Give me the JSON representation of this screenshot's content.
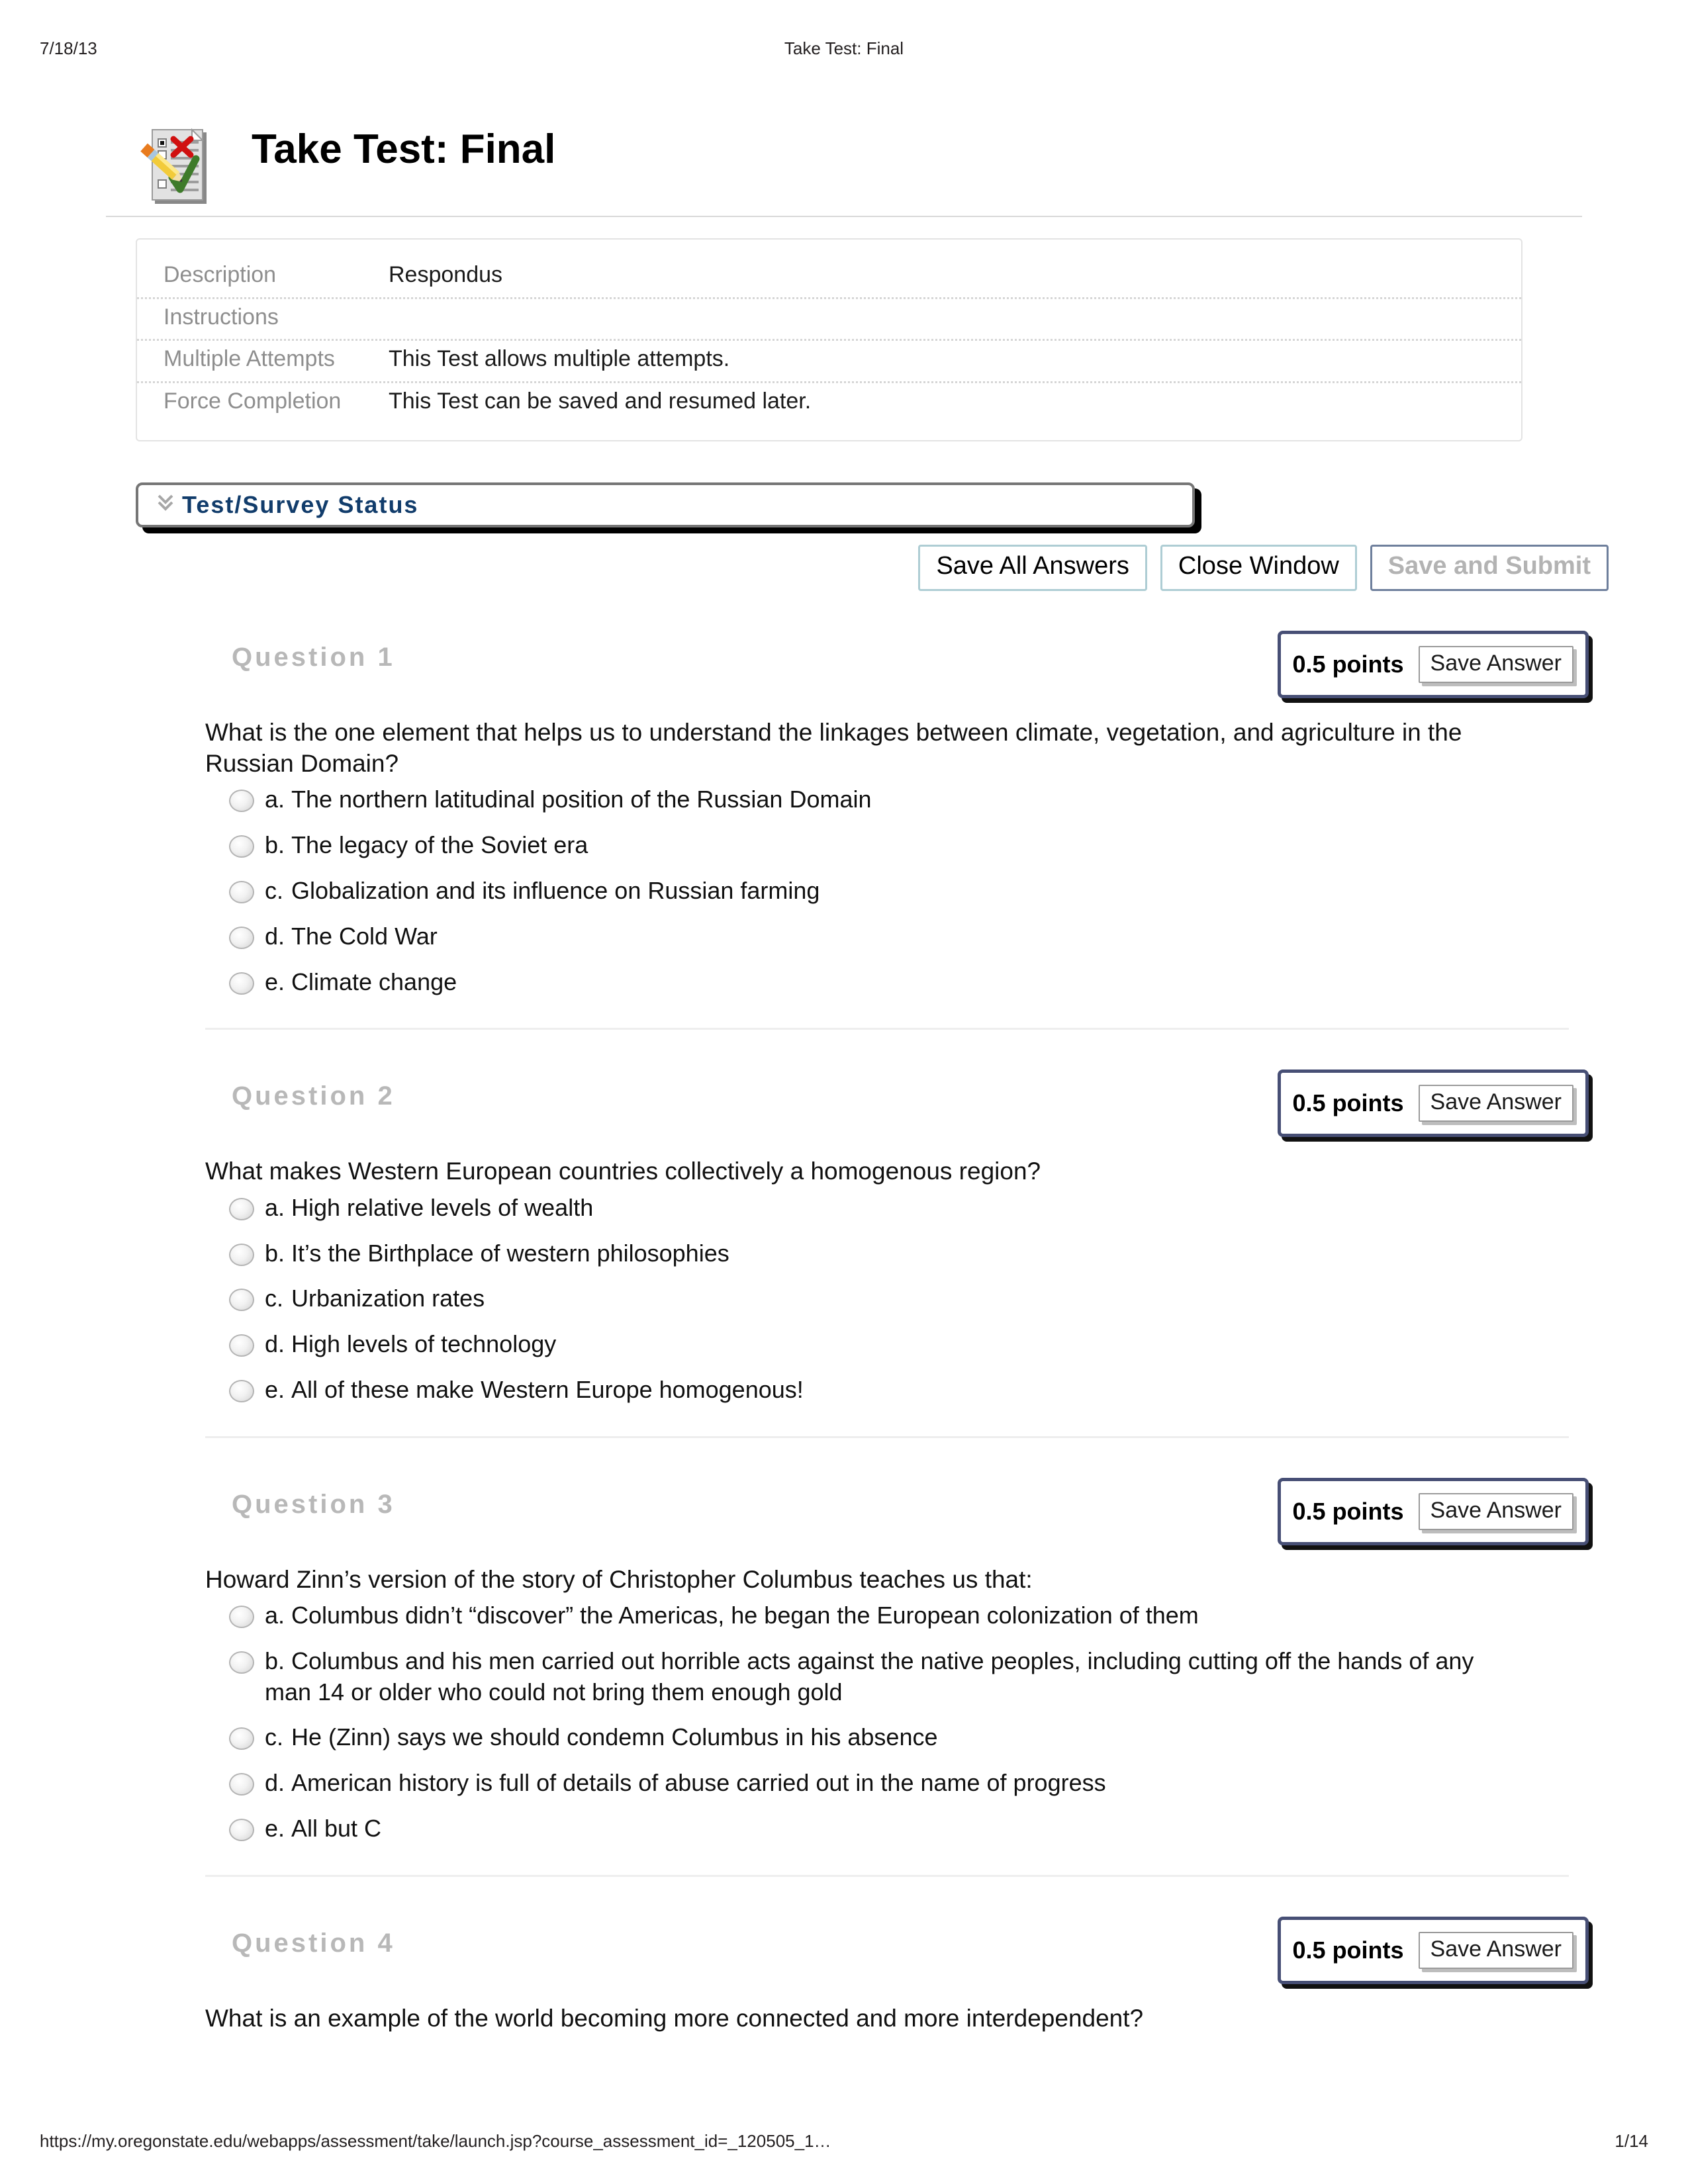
{
  "print_header": {
    "date": "7/18/13",
    "title": "Take Test: Final"
  },
  "print_footer": {
    "url": "https://my.oregonstate.edu/webapps/assessment/take/launch.jsp?course_assessment_id=_120505_1…",
    "page": "1/14"
  },
  "page_title": "Take Test: Final",
  "icon": "test-checklist-icon",
  "details": {
    "rows": [
      {
        "label": "Description",
        "value": "Respondus"
      },
      {
        "label": "Instructions",
        "value": ""
      },
      {
        "label": "Multiple Attempts",
        "value": "This Test allows multiple attempts."
      },
      {
        "label": "Force Completion",
        "value": "This Test can be saved and resumed later."
      }
    ]
  },
  "status": {
    "chevron": "»",
    "label": "Test/Survey Status"
  },
  "toolbar": {
    "save_all_label": "Save All Answers",
    "close_window_label": "Close Window",
    "save_submit_label": "Save and Submit"
  },
  "colors": {
    "accent_blue": "#113c6b",
    "points_border": "#474f75",
    "button_border": "#aecdd4",
    "disabled_text": "#b3b3b3",
    "question_number": "#b8b8b8"
  },
  "save_answer_label": "Save Answer",
  "questions": [
    {
      "number": "Question 1",
      "points": "0.5 points",
      "text": "What is the one element that helps us to understand the linkages between climate, vegetation, and agriculture in the Russian Domain?",
      "options": [
        {
          "letter": "a.",
          "text": "The northern latitudinal position of the Russian Domain"
        },
        {
          "letter": "b.",
          "text": "The legacy of the Soviet era"
        },
        {
          "letter": "c.",
          "text": "Globalization and its influence on Russian farming"
        },
        {
          "letter": "d.",
          "text": "The Cold War"
        },
        {
          "letter": "e.",
          "text": "Climate change"
        }
      ]
    },
    {
      "number": "Question 2",
      "points": "0.5 points",
      "text": "What makes Western European countries collectively a homogenous region?",
      "options": [
        {
          "letter": "a.",
          "text": "High relative levels of wealth"
        },
        {
          "letter": "b.",
          "text": "It’s the Birthplace of western philosophies"
        },
        {
          "letter": "c.",
          "text": "Urbanization rates"
        },
        {
          "letter": "d.",
          "text": "High levels of technology"
        },
        {
          "letter": "e.",
          "text": "All of these make Western Europe homogenous!"
        }
      ]
    },
    {
      "number": "Question 3",
      "points": "0.5 points",
      "text": "Howard Zinn’s version of the story of Christopher Columbus teaches us that:",
      "options": [
        {
          "letter": "a.",
          "text": "Columbus didn’t “discover” the Americas, he began the European colonization of them"
        },
        {
          "letter": "b.",
          "text": "Columbus and his men carried out horrible acts against the native peoples, including cutting off the hands of any man 14 or older who could not bring them enough gold"
        },
        {
          "letter": "c.",
          "text": "He (Zinn) says we should condemn Columbus in his absence"
        },
        {
          "letter": "d.",
          "text": "American history is full of details of abuse carried out in the name of progress"
        },
        {
          "letter": "e.",
          "text": "All but C"
        }
      ]
    },
    {
      "number": "Question 4",
      "points": "0.5 points",
      "text": "What is an example of the world becoming more connected and more interdependent?",
      "options": []
    }
  ]
}
